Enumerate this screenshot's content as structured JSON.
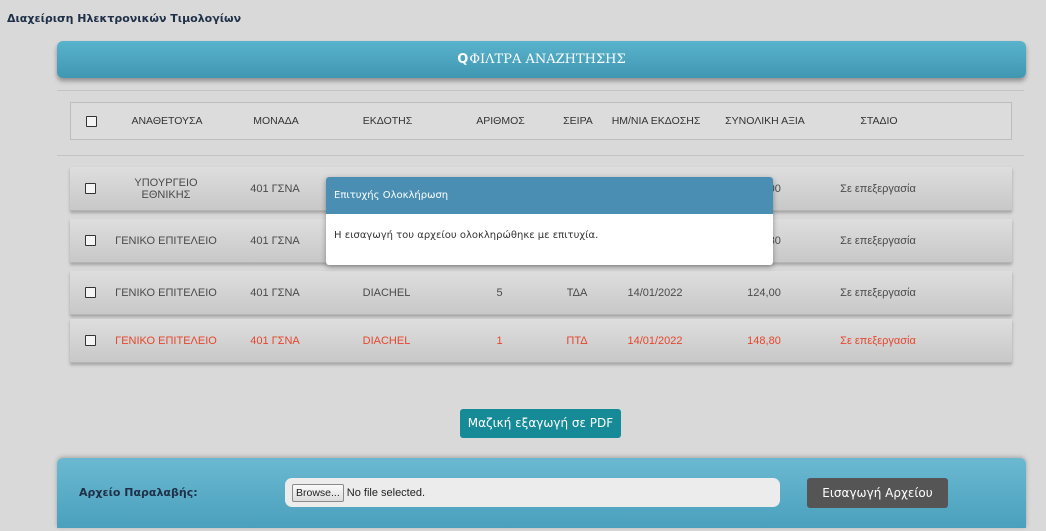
{
  "page": {
    "title": "Διαχείριση Ηλεκτρονικών Τιμολογίων"
  },
  "filters": {
    "icon": "search-icon",
    "label": "ΦΙΛΤΡΑ ΑΝΑΖΗΤΗΣΗΣ"
  },
  "table": {
    "headers": [
      "ΑΝΑΘΕΤΟΥΣΑ",
      "ΜΟΝΑΔΑ",
      "ΕΚΔΟΤΗΣ",
      "ΑΡΙΘΜΟΣ",
      "ΣΕΙΡΑ",
      "ΗΜ/ΝΙΑ ΕΚΔΟΣΗΣ",
      "ΣΥΝΟΛΙΚΗ ΑΞΙΑ",
      "ΣΤΑΔΙΟ"
    ],
    "rows": [
      {
        "anatheτousa": "",
        "cells": [
          "ΥΠΟΥΡΓΕΙΟ ΕΘΝΙΚΗΣ",
          "401 ΓΣΝΑ",
          "",
          "",
          "",
          "",
          "124,00",
          "Σε επεξεργασία"
        ]
      },
      {
        "cells": [
          "ΓΕΝΙΚΟ ΕΠΙΤΕΛΕΙΟ",
          "401 ΓΣΝΑ",
          "",
          "",
          "",
          "",
          "148,80",
          "Σε επεξεργασία"
        ]
      },
      {
        "cells": [
          "ΓΕΝΙΚΟ ΕΠΙΤΕΛΕΙΟ",
          "401 ΓΣΝΑ",
          "DIACHEL",
          "5",
          "ΤΔΑ",
          "14/01/2022",
          "124,00",
          "Σε επεξεργασία"
        ]
      },
      {
        "cells": [
          "ΓΕΝΙΚΟ ΕΠΙΤΕΛΕΙΟ",
          "401 ΓΣΝΑ",
          "DIACHEL",
          "1",
          "ΠΤΔ",
          "14/01/2022",
          "148,80",
          "Σε επεξεργασία"
        ]
      }
    ],
    "highlight_color": "#e6462c"
  },
  "modal": {
    "title": "Επιτυχής Ολοκλήρωση",
    "message": "Η εισαγωγή του αρχείου ολοκληρώθηκε με επιτυχία."
  },
  "actions": {
    "export_pdf": "Μαζική εξαγωγή σε PDF"
  },
  "upload": {
    "label": "Αρχείο Παραλαβής:",
    "browse": "Browse...",
    "file_status": "No file selected.",
    "import_button": "Εισαγωγή Αρχείου"
  },
  "colors": {
    "accent": "#4aa0bd",
    "modal_header": "#4a8fb3",
    "pdf_button": "#168a96",
    "import_button": "#555555"
  }
}
